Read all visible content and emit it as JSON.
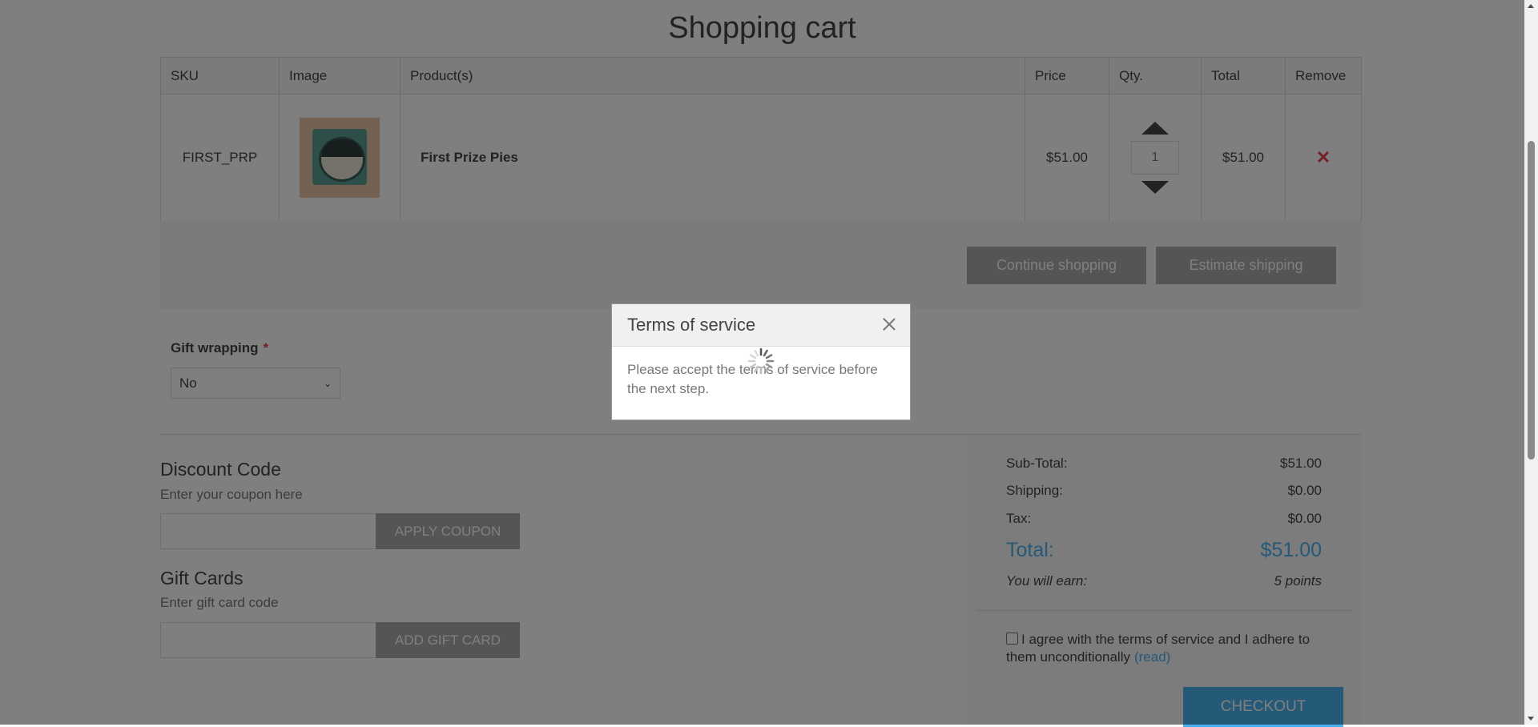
{
  "page": {
    "title": "Shopping cart"
  },
  "cart": {
    "headers": {
      "sku": "SKU",
      "image": "Image",
      "product": "Product(s)",
      "price": "Price",
      "qty": "Qty.",
      "total": "Total",
      "remove": "Remove"
    },
    "items": [
      {
        "sku": "FIRST_PRP",
        "product_name": "First Prize Pies",
        "price": "$51.00",
        "qty": "1",
        "total": "$51.00",
        "remove_icon": "remove-x-icon"
      }
    ],
    "actions": {
      "continue_label": "Continue shopping",
      "estimate_label": "Estimate shipping"
    }
  },
  "gift_wrapping": {
    "label": "Gift wrapping",
    "required_mark": "*",
    "selected": "No"
  },
  "discount": {
    "title": "Discount Code",
    "hint": "Enter your coupon here",
    "button": "APPLY COUPON"
  },
  "gift_cards": {
    "title": "Gift Cards",
    "hint": "Enter gift card code",
    "button": "ADD GIFT CARD"
  },
  "totals": {
    "subtotal_label": "Sub-Total:",
    "subtotal_value": "$51.00",
    "shipping_label": "Shipping:",
    "shipping_value": "$0.00",
    "tax_label": "Tax:",
    "tax_value": "$0.00",
    "total_label": "Total:",
    "total_value": "$51.00",
    "earn_label": "You will earn:",
    "earn_value": "5 points",
    "terms_text": "I agree with the terms of service and I adhere to them unconditionally",
    "terms_link": "(read)",
    "checkout": "CHECKOUT"
  },
  "modal": {
    "title": "Terms of service",
    "message": "Please accept the terms of service before the next step."
  },
  "colors": {
    "accent": "#4ab2f1",
    "required": "#e4434b",
    "button_gray": "#aaaaaa"
  }
}
